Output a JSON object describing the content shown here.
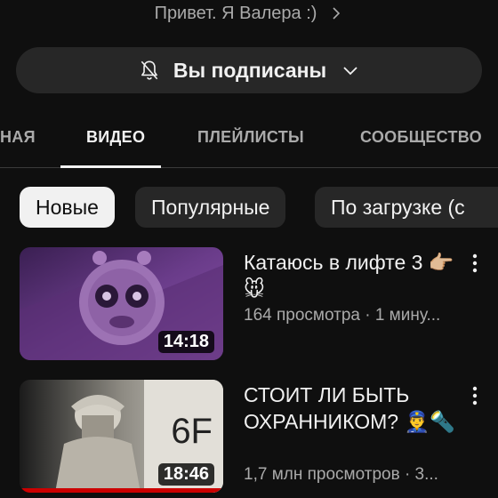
{
  "channel": {
    "description_preview": "Привет. Я Валера :)",
    "subscribe_button_label": "Вы подписаны"
  },
  "tabs": [
    "НАЯ",
    "ВИДЕО",
    "ПЛЕЙЛИСТЫ",
    "СООБЩЕСТВО"
  ],
  "active_tab": "ВИДЕО",
  "filter_chips": [
    "Новые",
    "Популярные",
    "По загрузке (с"
  ],
  "active_chip": "Новые",
  "videos": [
    {
      "title": "Катаюсь в лифте 3 👉🏼🐭",
      "meta": "164 просмотра · 1 мину...",
      "duration": "14:18"
    },
    {
      "title": "СТОИТ ЛИ БЫТЬ ОХРАННИКОМ? 👮‍♂️🔦",
      "meta": "1,7 млн просмотров · 3...",
      "duration": "18:46",
      "thumbnail_text": "6F",
      "watched": true
    }
  ],
  "colors": {
    "background": "#0f0f0f",
    "chip_active_bg": "#f1f1f1",
    "chip_bg": "#272727",
    "secondary_text": "#aaaaaa",
    "progress": "#cc0000"
  },
  "icons": {
    "subscribe": "bell-off-icon",
    "subscribe_menu": "chevron-down-icon",
    "description_more": "chevron-right-icon",
    "video_menu": "more-vert-icon"
  }
}
